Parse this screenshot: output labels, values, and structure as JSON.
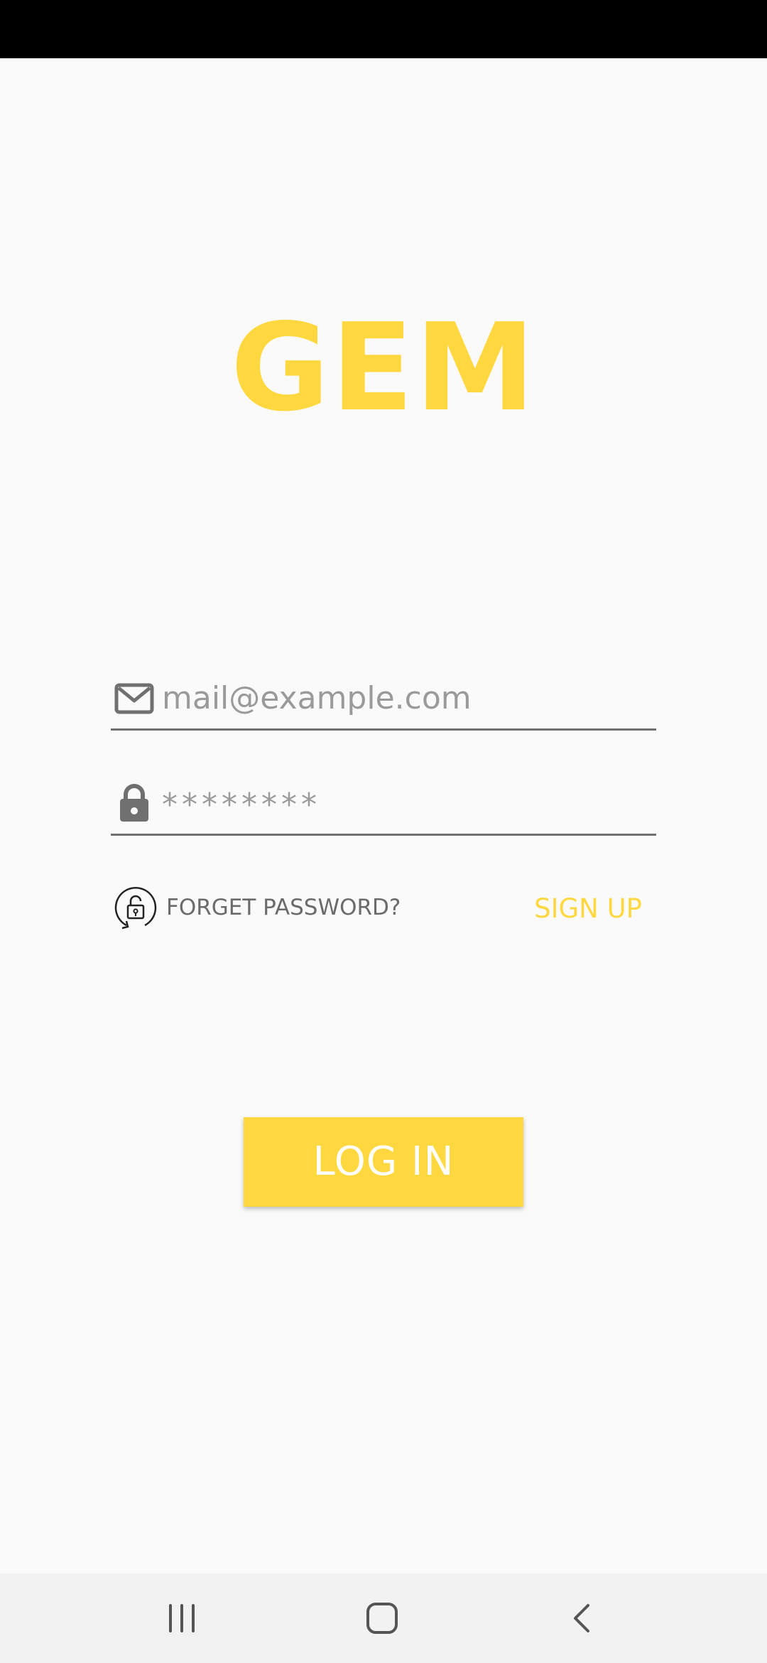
{
  "app": {
    "title": "GEM"
  },
  "login_form": {
    "email_placeholder": "mail@example.com",
    "password_value": "********",
    "forget_password_label": "FORGET PASSWORD?",
    "sign_up_label": "SIGN UP",
    "login_button_label": "LOG IN"
  },
  "icons": {
    "email": "mail-icon",
    "password": "lock-icon",
    "forget": "lock-reset-icon",
    "nav_recents": "recents-icon",
    "nav_home": "home-icon",
    "nav_back": "back-icon"
  },
  "colors": {
    "accent": "#ffd83f",
    "background": "#fafafa",
    "text_muted": "#9a9a9a",
    "icon_gray": "#707070"
  }
}
